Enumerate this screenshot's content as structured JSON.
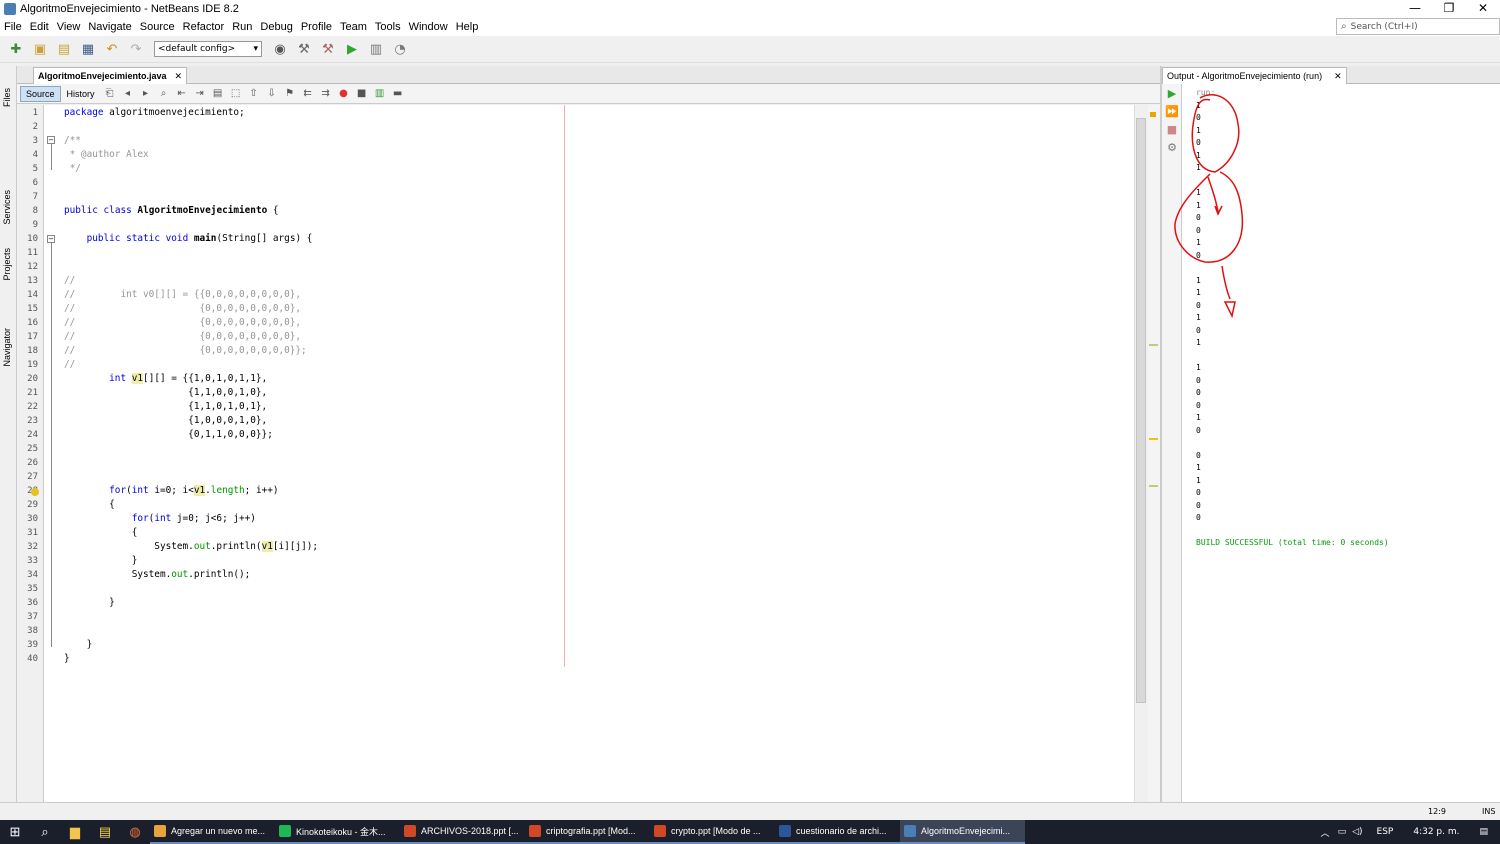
{
  "window": {
    "title": "AlgoritmoEnvejecimiento - NetBeans IDE 8.2",
    "controls": [
      "—",
      "❐",
      "✕"
    ]
  },
  "menu": [
    "File",
    "Edit",
    "View",
    "Navigate",
    "Source",
    "Refactor",
    "Run",
    "Debug",
    "Profile",
    "Team",
    "Tools",
    "Window",
    "Help"
  ],
  "search": {
    "placeholder": "Search (Ctrl+I)"
  },
  "toolbar": {
    "config": "<default config>"
  },
  "side_tabs": [
    "Files",
    "Services",
    "Projects",
    "Navigator"
  ],
  "editor": {
    "tab": "AlgoritmoEnvejecimiento.java",
    "modes": [
      "Source",
      "History"
    ],
    "lines": [
      {
        "n": "1",
        "text": "package algoritmoenvejecimiento;"
      },
      {
        "n": "2",
        "text": ""
      },
      {
        "n": "3",
        "text": "/**"
      },
      {
        "n": "4",
        "text": " * @author Alex"
      },
      {
        "n": "5",
        "text": " */"
      },
      {
        "n": "6",
        "text": ""
      },
      {
        "n": "7",
        "text": ""
      },
      {
        "n": "8",
        "text": "public class AlgoritmoEnvejecimiento {"
      },
      {
        "n": "9",
        "text": ""
      },
      {
        "n": "10",
        "text": "    public static void main(String[] args) {"
      },
      {
        "n": "11",
        "text": ""
      },
      {
        "n": "12",
        "text": ""
      },
      {
        "n": "13",
        "text": "//"
      },
      {
        "n": "14",
        "text": "//        int v0[][] = {{0,0,0,0,0,0,0,0},"
      },
      {
        "n": "15",
        "text": "//                      {0,0,0,0,0,0,0,0},"
      },
      {
        "n": "16",
        "text": "//                      {0,0,0,0,0,0,0,0},"
      },
      {
        "n": "17",
        "text": "//                      {0,0,0,0,0,0,0,0},"
      },
      {
        "n": "18",
        "text": "//                      {0,0,0,0,0,0,0,0}};"
      },
      {
        "n": "19",
        "text": "//"
      },
      {
        "n": "20",
        "text": "        int v1[][] = {{1,0,1,0,1,1},"
      },
      {
        "n": "21",
        "text": "                      {1,1,0,0,1,0},"
      },
      {
        "n": "22",
        "text": "                      {1,1,0,1,0,1},"
      },
      {
        "n": "23",
        "text": "                      {1,0,0,0,1,0},"
      },
      {
        "n": "24",
        "text": "                      {0,1,1,0,0,0}};"
      },
      {
        "n": "25",
        "text": ""
      },
      {
        "n": "26",
        "text": ""
      },
      {
        "n": "27",
        "text": ""
      },
      {
        "n": "28",
        "text": "        for(int i=0; i<v1.length; i++)"
      },
      {
        "n": "29",
        "text": "        {"
      },
      {
        "n": "30",
        "text": "            for(int j=0; j<6; j++)"
      },
      {
        "n": "31",
        "text": "            {"
      },
      {
        "n": "32",
        "text": "                System.out.println(v1[i][j]);"
      },
      {
        "n": "33",
        "text": "            }"
      },
      {
        "n": "34",
        "text": "            System.out.println();"
      },
      {
        "n": "35",
        "text": ""
      },
      {
        "n": "36",
        "text": "        }"
      },
      {
        "n": "37",
        "text": ""
      },
      {
        "n": "38",
        "text": ""
      },
      {
        "n": "39",
        "text": "    }"
      },
      {
        "n": "40",
        "text": "}"
      }
    ]
  },
  "output": {
    "tab": "Output - AlgoritmoEnvejecimiento (run)",
    "lines": [
      "run:",
      "1",
      "0",
      "1",
      "0",
      "1",
      "1",
      "",
      "1",
      "1",
      "0",
      "0",
      "1",
      "0",
      "",
      "1",
      "1",
      "0",
      "1",
      "0",
      "1",
      "",
      "1",
      "0",
      "0",
      "0",
      "1",
      "0",
      "",
      "0",
      "1",
      "1",
      "0",
      "0",
      "0",
      "",
      "BUILD SUCCESSFUL (total time: 0 seconds)"
    ]
  },
  "status": {
    "position": "12:9",
    "mode": "INS"
  },
  "taskbar": {
    "apps": [
      {
        "label": "Agregar un nuevo me...",
        "color": "#e8a33a"
      },
      {
        "label": "Kinokoteikoku - 金木...",
        "color": "#1db954"
      },
      {
        "label": "ARCHIVOS-2018.ppt [...",
        "color": "#d24726"
      },
      {
        "label": "criptografia.ppt [Mod...",
        "color": "#d24726"
      },
      {
        "label": "crypto.ppt [Modo de ...",
        "color": "#d24726"
      },
      {
        "label": "cuestionario de archi...",
        "color": "#2b579a"
      },
      {
        "label": "AlgoritmoEnvejecimi...",
        "color": "#4a7fb5"
      }
    ],
    "lang": "ESP",
    "time": "4:32 p. m."
  }
}
